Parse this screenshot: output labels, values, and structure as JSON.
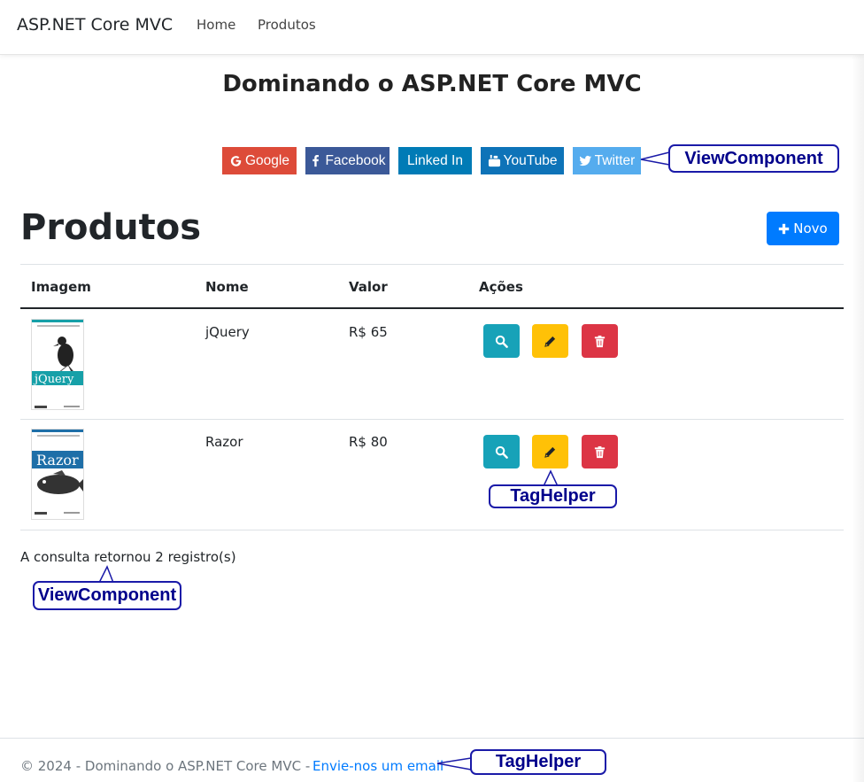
{
  "navbar": {
    "brand": "ASP.NET Core MVC",
    "links": [
      "Home",
      "Produtos"
    ]
  },
  "site_title": "Dominando o ASP.NET Core MVC",
  "social": [
    {
      "label": "Google",
      "icon": "google-icon",
      "color": "#dd4b39"
    },
    {
      "label": "Facebook",
      "icon": "facebook-icon",
      "color": "#3b5998"
    },
    {
      "label": "Linked In",
      "icon": "",
      "color": "#007bb6"
    },
    {
      "label": "YouTube",
      "icon": "youtube-icon",
      "color": "#0e73b8"
    },
    {
      "label": "Twitter",
      "icon": "twitter-icon",
      "color": "#55acee"
    }
  ],
  "annotations": {
    "social": "ViewComponent",
    "actions": "TagHelper",
    "count": "ViewComponent",
    "footer": "TagHelper"
  },
  "page": {
    "heading": "Produtos",
    "new_button": "Novo"
  },
  "table": {
    "headers": [
      "Imagem",
      "Nome",
      "Valor",
      "Ações"
    ],
    "rows": [
      {
        "name": "jQuery",
        "value": "R$ 65",
        "cover_title": "jQuery"
      },
      {
        "name": "Razor",
        "value": "R$ 80",
        "cover_title": "Razor"
      }
    ]
  },
  "count_text": "A consulta retornou 2 registro(s)",
  "footer": {
    "text": "© 2024 - Dominando o ASP.NET Core MVC -",
    "link": "Envie-nos um email"
  },
  "colors": {
    "primary": "#007bff",
    "info": "#17a2b8",
    "warning": "#ffc107",
    "danger": "#dc3545",
    "annotation": "#00008b"
  }
}
